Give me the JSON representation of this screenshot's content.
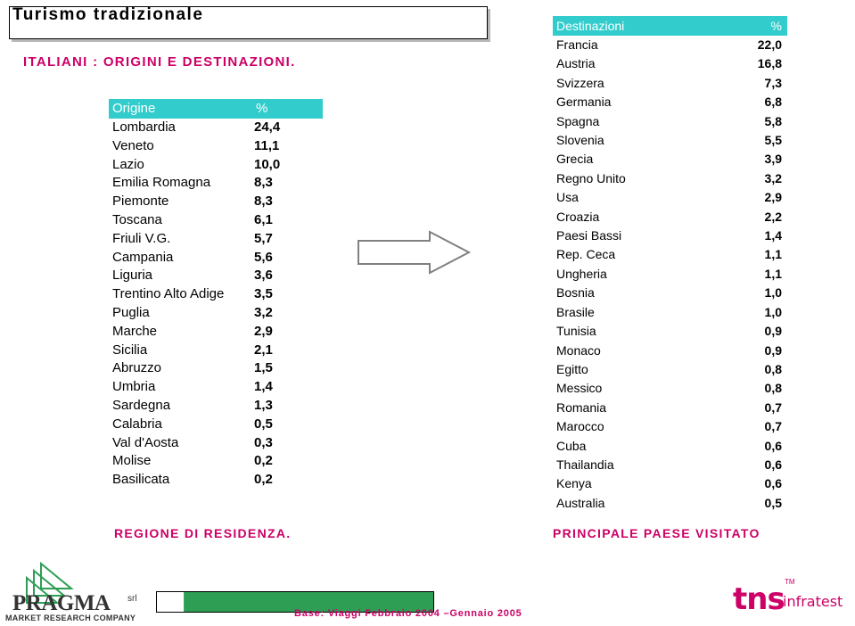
{
  "title": "Turismo tradizionale",
  "subtitle_left": "ITALIANI : ORIGINI E DESTINAZIONI.",
  "footer_left": "REGIONE DI RESIDENZA.",
  "footer_right": "PRINCIPALE PAESE VISITATO",
  "base_note": "Base: Viaggi Febbraio 2004 –Gennaio 2005",
  "colors": {
    "header_bg": "#33cccc",
    "accent_magenta": "#cc0066",
    "bar_green": "#2e9e54"
  },
  "left_table": {
    "headers": [
      "Origine",
      "%"
    ],
    "rows": [
      [
        "Lombardia",
        "24,4"
      ],
      [
        "Veneto",
        "11,1"
      ],
      [
        "Lazio",
        "10,0"
      ],
      [
        "Emilia Romagna",
        "8,3"
      ],
      [
        "Piemonte",
        "8,3"
      ],
      [
        "Toscana",
        "6,1"
      ],
      [
        "Friuli V.G.",
        "5,7"
      ],
      [
        "Campania",
        "5,6"
      ],
      [
        "Liguria",
        "3,6"
      ],
      [
        "Trentino Alto Adige",
        "3,5"
      ],
      [
        "Puglia",
        "3,2"
      ],
      [
        "Marche",
        "2,9"
      ],
      [
        "Sicilia",
        "2,1"
      ],
      [
        "Abruzzo",
        "1,5"
      ],
      [
        "Umbria",
        "1,4"
      ],
      [
        "Sardegna",
        "1,3"
      ],
      [
        "Calabria",
        "0,5"
      ],
      [
        "Val d'Aosta",
        "0,3"
      ],
      [
        "Molise",
        "0,2"
      ],
      [
        "Basilicata",
        "0,2"
      ]
    ]
  },
  "right_table": {
    "headers": [
      "Destinazioni",
      "%"
    ],
    "rows": [
      [
        "Francia",
        "22,0"
      ],
      [
        "Austria",
        "16,8"
      ],
      [
        "Svizzera",
        "7,3"
      ],
      [
        "Germania",
        "6,8"
      ],
      [
        "Spagna",
        "5,8"
      ],
      [
        "Slovenia",
        "5,5"
      ],
      [
        "Grecia",
        "3,9"
      ],
      [
        "Regno Unito",
        "3,2"
      ],
      [
        "Usa",
        "2,9"
      ],
      [
        "Croazia",
        "2,2"
      ],
      [
        "Paesi Bassi",
        "1,4"
      ],
      [
        "Rep. Ceca",
        "1,1"
      ],
      [
        "Ungheria",
        "1,1"
      ],
      [
        "Bosnia",
        "1,0"
      ],
      [
        "Brasile",
        "1,0"
      ],
      [
        "Tunisia",
        "0,9"
      ],
      [
        "Monaco",
        "0,9"
      ],
      [
        "Egitto",
        "0,8"
      ],
      [
        "Messico",
        "0,8"
      ],
      [
        "Romania",
        "0,7"
      ],
      [
        "Marocco",
        "0,7"
      ],
      [
        "Cuba",
        "0,6"
      ],
      [
        "Thailandia",
        "0,6"
      ],
      [
        "Kenya",
        "0,6"
      ],
      [
        "Australia",
        "0,5"
      ]
    ]
  },
  "logos": {
    "pragma_name": "PRAGMA",
    "pragma_srl": "srl",
    "pragma_tagline": "MARKET RESEARCH COMPANY",
    "tns_word": "tns",
    "tns_sub": "infratest",
    "tns_tm": "TM"
  }
}
